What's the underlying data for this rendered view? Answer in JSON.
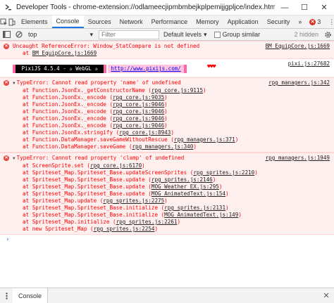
{
  "window": {
    "title": "Developer Tools - chrome-extension://odlameecjipmbmbejkplpemijjgpljce/index.html",
    "minimize_glyph": "—",
    "maximize_glyph": "☐",
    "close_glyph": "✕"
  },
  "tabs": [
    {
      "label": "Elements"
    },
    {
      "label": "Console"
    },
    {
      "label": "Sources"
    },
    {
      "label": "Network"
    },
    {
      "label": "Performance"
    },
    {
      "label": "Memory"
    },
    {
      "label": "Application"
    },
    {
      "label": "Security"
    }
  ],
  "tabbar": {
    "more_glyph": "»",
    "error_count": "3",
    "menu_glyph": "⋮"
  },
  "toolbar": {
    "context": "top",
    "filter_placeholder": "Filter",
    "levels": "Default levels",
    "group_similar": "Group similar",
    "hidden": "2 hidden"
  },
  "messages": {
    "m1": {
      "line": "Uncaught ReferenceError: Window_StatCompare is not defined",
      "source": "BM EquipCore.js:1669",
      "sub": "at BM EquipCore.js:1669",
      "sub_prefix": "at ",
      "sub_link": "BM EquipCore.js:1669"
    },
    "pixi": {
      "source": "pixi.js:27682",
      "banner": " PixiJS 4.5.4 - ✰ WebGL ✰ ",
      "url": "http://www.pixijs.com/",
      "hearts": "♥♥♥"
    },
    "m2": {
      "line": "TypeError: Cannot read property 'name' of undefined",
      "source": "rpg managers.js:342",
      "frames": [
        {
          "text": "at Function.JsonEx._getConstructorName (",
          "link": "rpg core.js:9115",
          "close": ")"
        },
        {
          "text": "at Function.JsonEx._encode (",
          "link": "rpg core.js:9035",
          "close": ")"
        },
        {
          "text": "at Function.JsonEx._encode (",
          "link": "rpg core.js:9046",
          "close": ")"
        },
        {
          "text": "at Function.JsonEx._encode (",
          "link": "rpg core.js:9046",
          "close": ")"
        },
        {
          "text": "at Function.JsonEx._encode (",
          "link": "rpg core.js:9046",
          "close": ")"
        },
        {
          "text": "at Function.JsonEx._encode (",
          "link": "rpg core.js:9046",
          "close": ")"
        },
        {
          "text": "at Function.JsonEx.stringify (",
          "link": "rpg core.js:8943",
          "close": ")"
        },
        {
          "text": "at Function.DataManager.saveGameWithoutRescue (",
          "link": "rpg managers.js:371",
          "close": ")"
        },
        {
          "text": "at Function.DataManager.saveGame (",
          "link": "rpg managers.js:340",
          "close": ")"
        }
      ]
    },
    "m3": {
      "line": "TypeError: Cannot read property 'clamp' of undefined",
      "source": "rpg managers.js:1949",
      "frames": [
        {
          "text": "at ScreenSprite.set (",
          "link": "rpg core.js:6170",
          "close": ")"
        },
        {
          "text": "at Spriteset_Map.Spriteset_Base.updateScreenSprites (",
          "link": "rpg sprites.js:2210",
          "close": ")"
        },
        {
          "text": "at Spriteset_Map.Spriteset_Base.update (",
          "link": "rpg sprites.js:2146",
          "close": ")"
        },
        {
          "text": "at Spriteset_Map.Spriteset_Base.update (",
          "link": "MOG Weather EX.js:295",
          "close": ")"
        },
        {
          "text": "at Spriteset_Map.Spriteset_Base.update (",
          "link": "MOG AnimatedText.js:154",
          "close": ")"
        },
        {
          "text": "at Spriteset_Map.update (",
          "link": "rpg sprites.js:2275",
          "close": ")"
        },
        {
          "text": "at Spriteset_Map.Spriteset_Base.initialize (",
          "link": "rpg sprites.js:2131",
          "close": ")"
        },
        {
          "text": "at Spriteset_Map.Spriteset_Base.initialize (",
          "link": "MOG AnimatedText.js:149",
          "close": ")"
        },
        {
          "text": "at Spriteset_Map.initialize (",
          "link": "rpg sprites.js:2261",
          "close": ")"
        },
        {
          "text": "at new Spriteset_Map (",
          "link": "rpg sprites.js:2254",
          "close": ")"
        }
      ]
    }
  },
  "prompt": "›",
  "drawer": {
    "tab": "Console",
    "close_glyph": "✕"
  },
  "colors": {
    "error_text": "#ff0000",
    "error_bg": "#fff0f0",
    "accent": "#1a73e8",
    "pixi_pink": "#ff66a5"
  }
}
